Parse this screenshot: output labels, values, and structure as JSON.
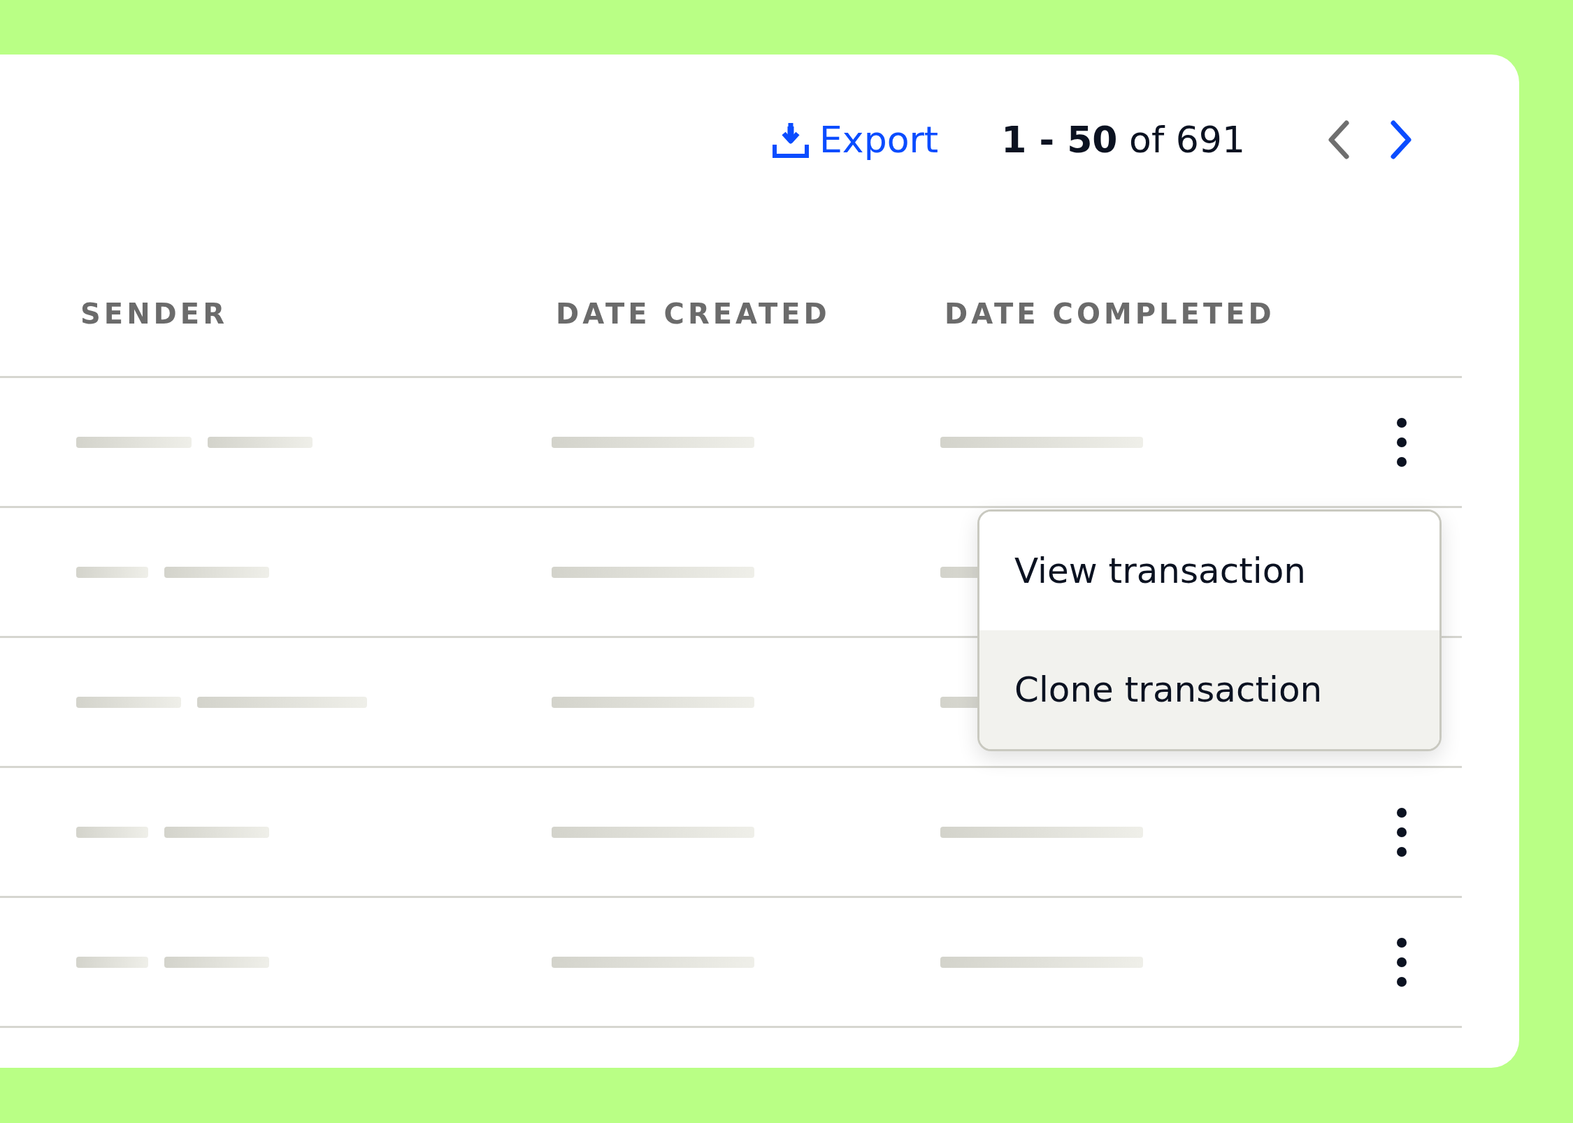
{
  "toolbar": {
    "export_label": "Export",
    "range": "**1 - 50** of 691",
    "prev": {
      "disabled": true
    },
    "next": {
      "disabled": false
    }
  },
  "table": {
    "columns": [
      "SENDER",
      "DATE CREATED",
      "DATE COMPLETED"
    ],
    "rows": [
      {
        "actions_visible": true
      },
      {
        "actions_visible": false
      },
      {
        "actions_visible": false
      },
      {
        "actions_visible": true
      },
      {
        "actions_visible": true
      }
    ]
  },
  "menu": {
    "items": [
      {
        "label": "View transaction",
        "selected": false
      },
      {
        "label": "Clone transaction",
        "selected": true
      }
    ]
  }
}
